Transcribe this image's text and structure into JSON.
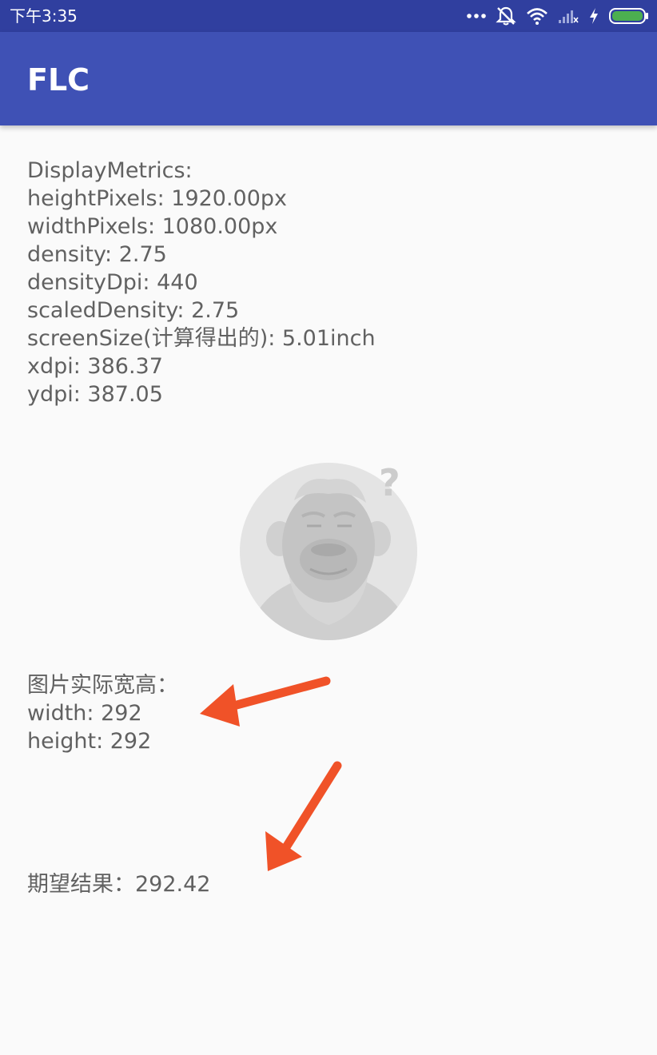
{
  "status_bar": {
    "time": "下午3:35",
    "icons": [
      "more-dots-icon",
      "mute-bell-icon",
      "wifi-icon",
      "signal-icon",
      "charging-bolt-icon",
      "battery-icon"
    ]
  },
  "app_bar": {
    "title": "FLC"
  },
  "display_metrics": {
    "heading": "DisplayMetrics:",
    "height_pixels": "heightPixels: 1920.00px",
    "width_pixels": "widthPixels: 1080.00px",
    "density": "density: 2.75",
    "density_dpi": "densityDpi: 440",
    "scaled_density": "scaledDensity: 2.75",
    "screen_size": "screenSize(计算得出的): 5.01inch",
    "xdpi": "xdpi: 386.37",
    "ydpi": "ydpi: 387.05"
  },
  "image_size": {
    "heading": "图片实际宽高：",
    "width": "width: 292",
    "height": "height: 292"
  },
  "expected_result": "期望结果：292.42",
  "colors": {
    "status_bar": "#303f9f",
    "app_bar": "#3f51b5",
    "body_text": "#616161",
    "background": "#fafafa",
    "arrow": "#f05228",
    "battery": "#4caf50"
  }
}
